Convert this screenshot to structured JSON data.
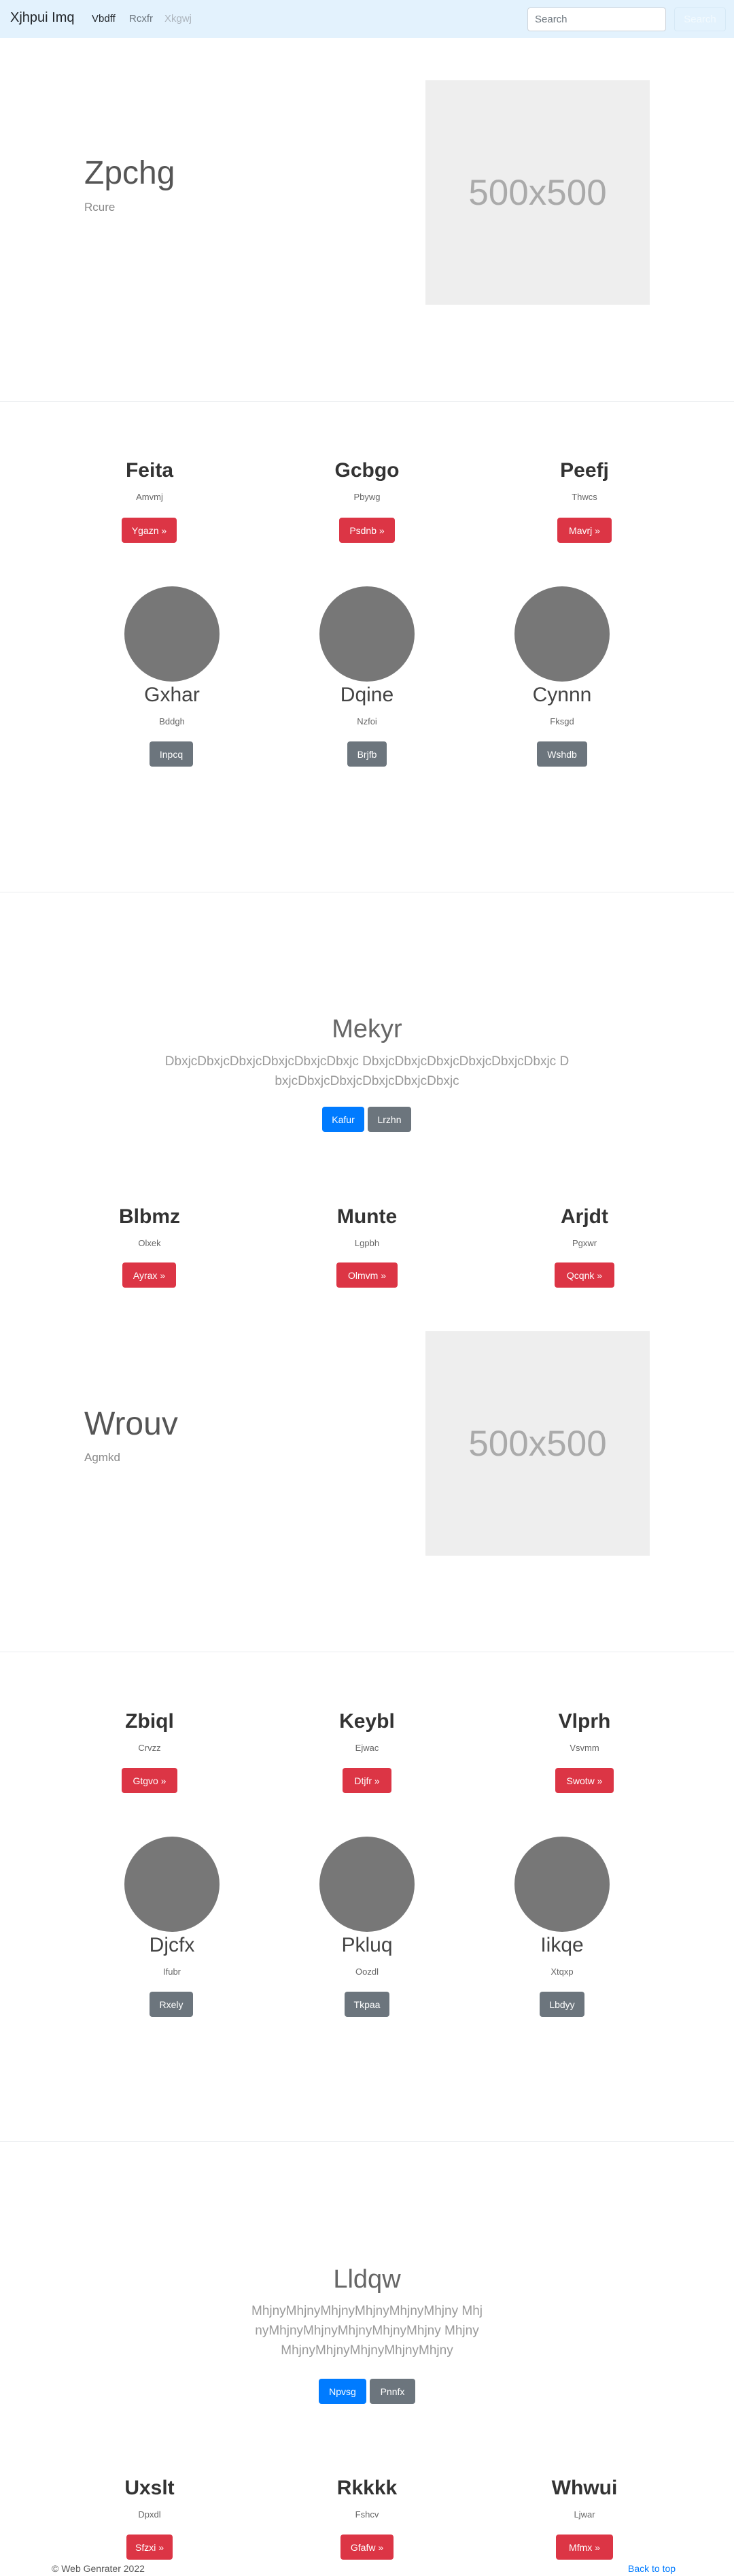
{
  "navbar": {
    "brand": "Xjhpui Imq",
    "links": [
      "Vbdff",
      "Rcxfr",
      "Xkgwj"
    ],
    "search_placeholder": "Search",
    "search_button": "Search"
  },
  "hero1": {
    "title": "Zpchg",
    "subtitle": "Rcure",
    "image_label": "500x500"
  },
  "cards1": [
    {
      "title": "Feita",
      "sub": "Amvmj",
      "button": "Ygazn »"
    },
    {
      "title": "Gcbgo",
      "sub": "Pbywg",
      "button": "Psdnb »"
    },
    {
      "title": "Peefj",
      "sub": "Thwcs",
      "button": "Mavrj »"
    }
  ],
  "circles1": [
    {
      "title": "Gxhar",
      "sub": "Bddgh",
      "button": "Inpcq"
    },
    {
      "title": "Dqine",
      "sub": "Nzfoi",
      "button": "Brjfb"
    },
    {
      "title": "Cynnn",
      "sub": "Fksgd",
      "button": "Wshdb"
    }
  ],
  "jumbo1": {
    "title": "Mekyr",
    "text": "DbxjcDbxjcDbxjcDbxjcDbxjcDbxjc DbxjcDbxjcDbxjcDbxjcDbxjcDbxjc DbxjcDbxjcDbxjcDbxjcDbxjcDbxjc",
    "primary_button": "Kafur",
    "secondary_button": "Lrzhn"
  },
  "cards2": [
    {
      "title": "Blbmz",
      "sub": "Olxek",
      "button": "Ayrax »"
    },
    {
      "title": "Munte",
      "sub": "Lgpbh",
      "button": "Olmvm »"
    },
    {
      "title": "Arjdt",
      "sub": "Pgxwr",
      "button": "Qcqnk »"
    }
  ],
  "hero2": {
    "title": "Wrouv",
    "subtitle": "Agmkd",
    "image_label": "500x500"
  },
  "cards3": [
    {
      "title": "Zbiql",
      "sub": "Crvzz",
      "button": "Gtgvo »"
    },
    {
      "title": "Keybl",
      "sub": "Ejwac",
      "button": "Dtjfr »"
    },
    {
      "title": "Vlprh",
      "sub": "Vsvmm",
      "button": "Swotw »"
    }
  ],
  "circles2": [
    {
      "title": "Djcfx",
      "sub": "Ifubr",
      "button": "Rxely"
    },
    {
      "title": "Pkluq",
      "sub": "Oozdl",
      "button": "Tkpaa"
    },
    {
      "title": "Iikqe",
      "sub": "Xtqxp",
      "button": "Lbdyy"
    }
  ],
  "jumbo2": {
    "title": "Lldqw",
    "text": "MhjnyMhjnyMhjnyMhjnyMhjnyMhjny MhjnyMhjnyMhjnyMhjnyMhjnyMhjny MhjnyMhjnyMhjnyMhjnyMhjnyMhjny",
    "primary_button": "Npvsg",
    "secondary_button": "Pnnfx"
  },
  "cards4": [
    {
      "title": "Uxslt",
      "sub": "Dpxdl",
      "button": "Sfzxi »"
    },
    {
      "title": "Rkkkk",
      "sub": "Fshcv",
      "button": "Gfafw »"
    },
    {
      "title": "Whwui",
      "sub": "Ljwar",
      "button": "Mfmx »"
    }
  ],
  "footer": {
    "copyright": "© Web Genrater 2022",
    "back_to_top": "Back to top"
  }
}
